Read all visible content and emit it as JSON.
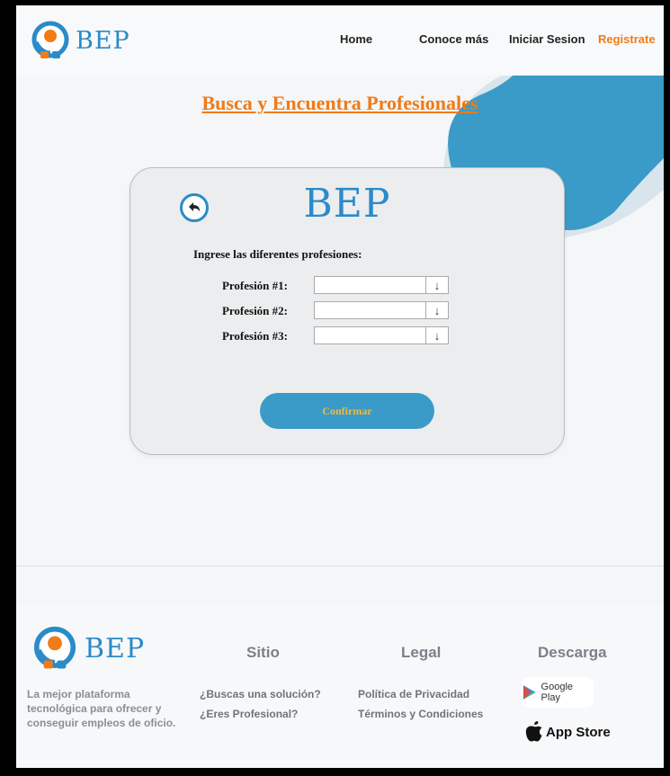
{
  "header": {
    "brand": "BEP",
    "nav": [
      {
        "label": "Home"
      },
      {
        "label": "Conoce más"
      },
      {
        "label": "Iniciar Sesion"
      },
      {
        "label": "Registrate"
      }
    ]
  },
  "hero": {
    "title": "Busca y Encuentra Profesionales"
  },
  "form": {
    "brand": "BEP",
    "instruction": "Ingrese las diferentes profesiones:",
    "rows": [
      {
        "label": "Profesión #1:",
        "value": ""
      },
      {
        "label": "Profesión #2:",
        "value": ""
      },
      {
        "label": "Profesión #3:",
        "value": ""
      }
    ],
    "confirm_label": "Confirmar",
    "back_icon": "back-arrow-icon",
    "dropdown_icon": "arrow-down-icon"
  },
  "footer": {
    "brand": "BEP",
    "description": "La mejor plataforma tecnológica para ofrecer y conseguir empleos de oficio.",
    "columns": {
      "sitio": {
        "title": "Sitio",
        "links": [
          "¿Buscas una solución?",
          "¿Eres Profesional?"
        ]
      },
      "legal": {
        "title": "Legal",
        "links": [
          "Política de Privacidad",
          "Términos y Condiciones"
        ]
      },
      "descarga": {
        "title": "Descarga",
        "google_play": "Google Play",
        "app_store": "App Store"
      }
    }
  },
  "colors": {
    "brand_blue": "#2a8bc9",
    "accent_orange": "#f07b17",
    "button_blue": "#3a9bc8",
    "button_text": "#f6b93b"
  }
}
